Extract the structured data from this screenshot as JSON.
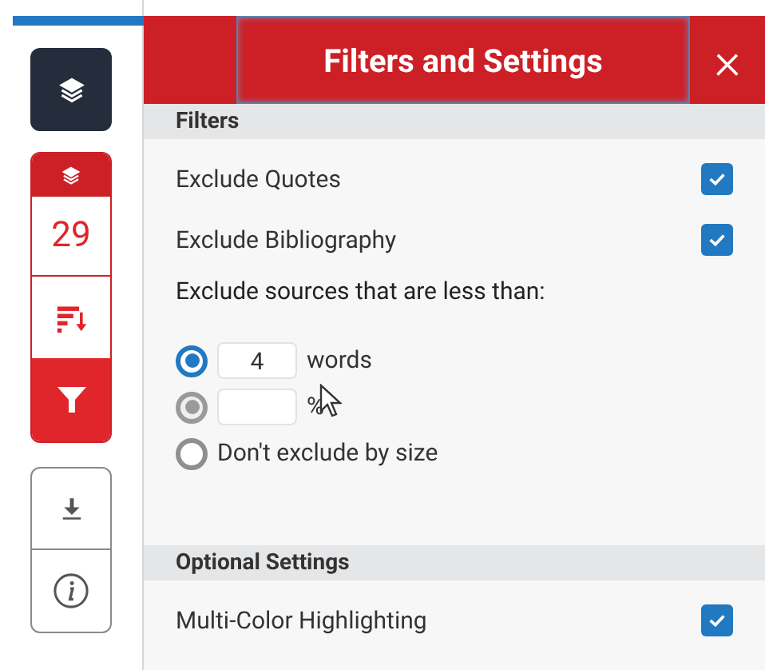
{
  "sidebar": {
    "layers_button": {
      "selected": true
    },
    "match_group": {
      "count": "29"
    }
  },
  "panel": {
    "title": "Filters and Settings",
    "close": "×",
    "sections": [
      {
        "heading": "Filters",
        "items": [
          {
            "kind": "checkbox",
            "label": "Exclude Quotes",
            "checked": true
          },
          {
            "kind": "checkbox",
            "label": "Exclude Bibliography",
            "checked": true
          },
          {
            "kind": "text",
            "label": "Exclude sources that are less than:"
          },
          {
            "kind": "radio",
            "value": "4",
            "unit": "words",
            "selected": true,
            "disabled": false
          },
          {
            "kind": "radio",
            "value": "",
            "unit": "%",
            "selected": true,
            "disabled": true
          },
          {
            "kind": "radio",
            "label": "Don't exclude by size",
            "selected": false,
            "disabled": false
          }
        ]
      },
      {
        "heading": "Optional Settings",
        "items": [
          {
            "kind": "checkbox",
            "label": "Multi-Color Highlighting",
            "checked": true
          }
        ]
      }
    ]
  }
}
